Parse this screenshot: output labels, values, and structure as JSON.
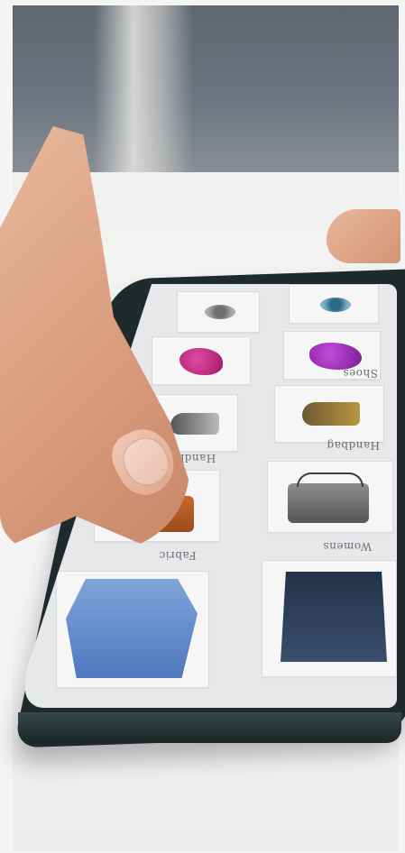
{
  "scene": {
    "description_hidden": "",
    "phone": {
      "labels": {
        "row2_right": "Shoes",
        "row3_right": "Handbag",
        "row3_left": "Handb",
        "row4_left": "Fabric",
        "row4_right": "Womens"
      }
    }
  },
  "colors": {
    "shirt": "#666d78",
    "table": "#f2f2f2",
    "phone_body": "#1f2a2c",
    "screen": "#e6e8ea",
    "skin": "#e0a68a"
  }
}
